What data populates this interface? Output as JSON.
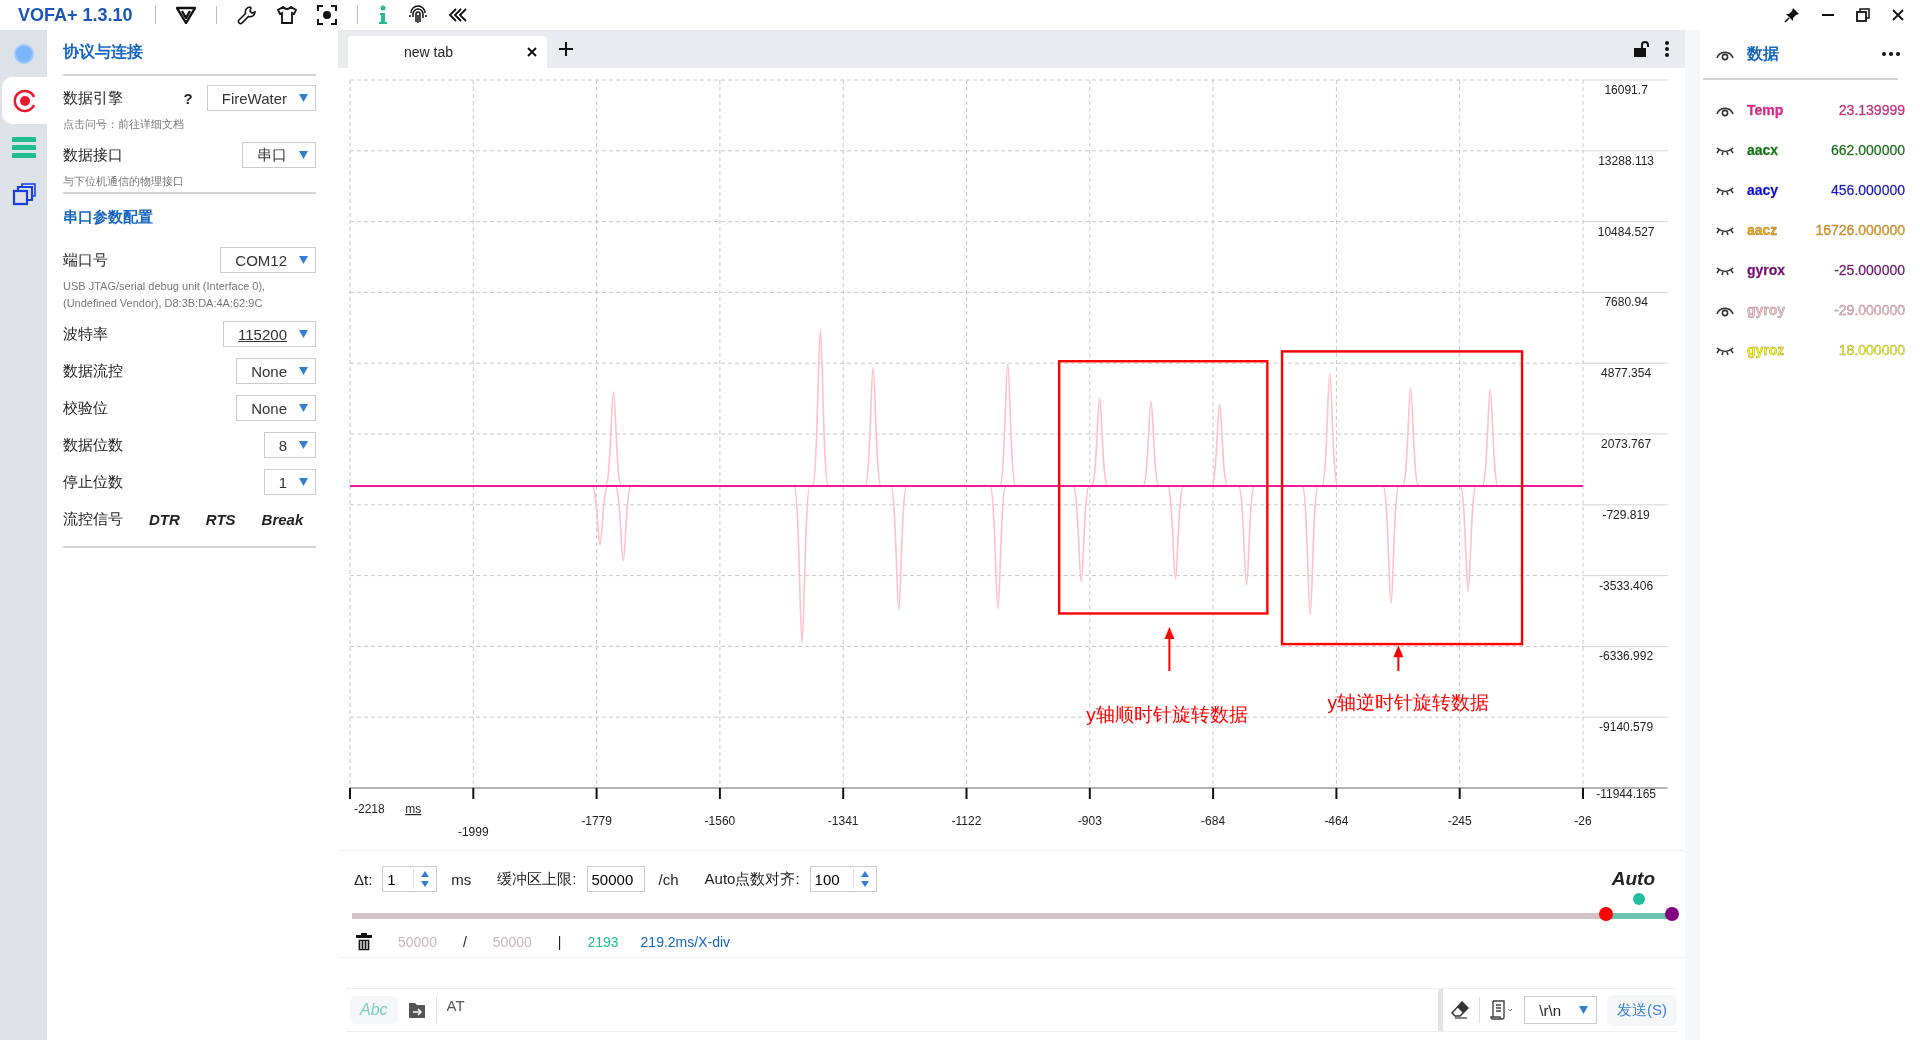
{
  "app": {
    "title": "VOFA+ 1.3.10"
  },
  "nav": [
    {
      "kind": "status",
      "selected": false
    },
    {
      "kind": "record",
      "selected": true
    },
    {
      "kind": "list",
      "selected": false
    },
    {
      "kind": "windows",
      "selected": false
    }
  ],
  "settings": [
    {
      "kind": "title",
      "text": "协议与连接"
    },
    {
      "kind": "select",
      "label": "数据引擎",
      "help": "?",
      "value": "FireWater",
      "hint": "点击问号：前往详细文档"
    },
    {
      "kind": "select",
      "label": "数据接口",
      "value": "串口",
      "hint": "与下位机通信的物理接口"
    },
    {
      "kind": "heading",
      "text": "串口参数配置"
    },
    {
      "kind": "select",
      "label": "端口号",
      "value": "COM12",
      "hint": "USB JTAG/serial debug unit (Interface 0), (Undefined Vendor), D8:3B:DA:4A:62:9C"
    },
    {
      "kind": "combo",
      "label": "波特率",
      "value": "115200"
    },
    {
      "kind": "select",
      "label": "数据流控",
      "value": "None"
    },
    {
      "kind": "select",
      "label": "校验位",
      "value": "None"
    },
    {
      "kind": "select",
      "label": "数据位数",
      "value": "8"
    },
    {
      "kind": "select",
      "label": "停止位数",
      "value": "1"
    },
    {
      "kind": "signals",
      "label": "流控信号",
      "options": [
        "DTR",
        "RTS",
        "Break"
      ]
    }
  ],
  "tabs": [
    {
      "label": "new tab",
      "selected": true
    }
  ],
  "chart": {
    "y_labels": [
      "16091.7",
      "13288.113",
      "10484.527",
      "7680.94",
      "4877.354",
      "2073.767",
      "-729.819",
      "-3533.406",
      "-6336.992",
      "-9140.579",
      "-11944.165"
    ],
    "x_labels": [
      "-2218",
      "-1999",
      "-1779",
      "-1560",
      "-1341",
      "-1122",
      "-903",
      "-684",
      "-464",
      "-245",
      "-26"
    ],
    "x_unit": "ms",
    "annotations": [
      {
        "label": "y轴顺时针旋转数据"
      },
      {
        "label": "y轴逆时针旋转数据"
      }
    ]
  },
  "controls": {
    "interval": {
      "label": "Δt:",
      "value": "1",
      "unit": "ms"
    },
    "buffer": {
      "label": "缓冲区上限:",
      "value": "50000",
      "unit": "/ch"
    },
    "align": {
      "label": "Auto点数对齐:",
      "value": "100"
    },
    "mode": "Auto",
    "range": {
      "level": 0.95
    }
  },
  "status": {
    "used": "50000",
    "slash": "/",
    "total": "50000",
    "bar": "|",
    "points": "2193",
    "scale": "219.2ms/X-div"
  },
  "send": {
    "mode": "Abc",
    "text": "AT",
    "line_ending": "\\r\\n",
    "button": "发送(S)"
  },
  "data_panel": {
    "title": "数据",
    "channels": [
      {
        "name": "Temp",
        "value": "23.139999",
        "color": "#ff1493",
        "visible": true
      },
      {
        "name": "aacx",
        "value": "662.000000",
        "color": "#008000",
        "visible": false
      },
      {
        "name": "aacy",
        "value": "456.000000",
        "color": "#0000ff",
        "visible": false
      },
      {
        "name": "aacz",
        "value": "16726.000000",
        "color": "#ffa500",
        "visible": false
      },
      {
        "name": "gyrox",
        "value": "-25.000000",
        "color": "#800080",
        "visible": false
      },
      {
        "name": "gyroy",
        "value": "-29.000000",
        "color": "#ffc0cb",
        "visible": true
      },
      {
        "name": "gyroz",
        "value": "18.000000",
        "color": "#ffff00",
        "visible": false
      }
    ]
  }
}
